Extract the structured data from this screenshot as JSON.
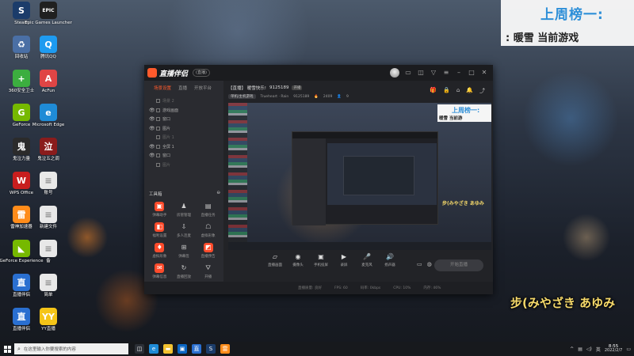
{
  "desktop": {
    "icons": [
      {
        "label": "Steam",
        "glyph": "S",
        "color": "#1b3c6a"
      },
      {
        "label": "Epic Games Launcher",
        "glyph": "EPIC",
        "color": "#202020"
      },
      {
        "label": "回收站",
        "glyph": "♻",
        "color": "#4a6fa5"
      },
      {
        "label": "腾讯QQ",
        "glyph": "Q",
        "color": "#1e9bf0"
      },
      {
        "label": "360安全卫士",
        "glyph": "+",
        "color": "#3cae3f"
      },
      {
        "label": "AcFun",
        "glyph": "A",
        "color": "#e04545"
      },
      {
        "label": "GeForce",
        "glyph": "G",
        "color": "#76b900"
      },
      {
        "label": "Microsoft Edge",
        "glyph": "e",
        "color": "#1f8bd6"
      },
      {
        "label": "鬼泣力量",
        "glyph": "鬼",
        "color": "#2b2b2b"
      },
      {
        "label": "鬼泣五之调",
        "glyph": "泣",
        "color": "#8a1c1c"
      },
      {
        "label": "WPS Office",
        "glyph": "W",
        "color": "#c81e1e"
      },
      {
        "label": "账号",
        "glyph": "≡",
        "color": "#e8e8e8"
      },
      {
        "label": "雷神加速器",
        "glyph": "雷",
        "color": "#ff8c1a"
      },
      {
        "label": "新建文件",
        "glyph": "≡",
        "color": "#e8e8e8"
      },
      {
        "label": "GeForce Experience",
        "glyph": "◣",
        "color": "#76b900"
      },
      {
        "label": "备",
        "glyph": "≡",
        "color": "#e8e8e8"
      },
      {
        "label": "直播伴侣",
        "glyph": "直",
        "color": "#2a6fd0"
      },
      {
        "label": "简单",
        "glyph": "≡",
        "color": "#e8e8e8"
      },
      {
        "label": "直播伴侣",
        "glyph": "直",
        "color": "#2a6fd0"
      },
      {
        "label": "YY直播",
        "glyph": "YY",
        "color": "#f5c518"
      }
    ]
  },
  "overlay": {
    "banner_title": "上周榜一:",
    "banner_sub": ": 暖雪   当前游戏",
    "lyric": "步(みやざき あゆみ"
  },
  "app": {
    "logo_text": "直播伴侣",
    "version": "(直播)",
    "side_tabs": [
      "场景设置",
      "直播",
      "开放平台"
    ],
    "scenes": [
      {
        "label": "场景 2",
        "eye": false
      },
      {
        "label": "游戏画面",
        "eye": true
      },
      {
        "label": "窗口",
        "eye": true
      },
      {
        "label": "图片",
        "eye": true
      },
      {
        "label": "图片 1",
        "eye": false
      },
      {
        "label": "全屏 1",
        "eye": true
      },
      {
        "label": "窗口",
        "eye": true
      },
      {
        "label": "图片",
        "eye": false
      }
    ],
    "toolbox_label": "工具箱",
    "tools": [
      {
        "label": "弹幕助手",
        "icon": "▣",
        "hot": true
      },
      {
        "label": "房管管理",
        "icon": "♟",
        "hot": false
      },
      {
        "label": "直播任务",
        "icon": "▤",
        "hot": false
      },
      {
        "label": "福利设置",
        "icon": "◧",
        "hot": true
      },
      {
        "label": "多人连麦",
        "icon": "⇩",
        "hot": false
      },
      {
        "label": "虚拟形象",
        "icon": "☖",
        "hot": false
      },
      {
        "label": "虚拟形象",
        "icon": "♦",
        "hot": true
      },
      {
        "label": "弹幕签",
        "icon": "⊞",
        "hot": false
      },
      {
        "label": "直播预告",
        "icon": "◩",
        "hot": true
      },
      {
        "label": "弹幕信息",
        "icon": "✉",
        "hot": true
      },
      {
        "label": "直播回放",
        "icon": "↻",
        "hot": false
      },
      {
        "label": "开播",
        "icon": "⛛",
        "hot": false
      }
    ],
    "side_footer": "您的直播间未开启更多功能请前往设置",
    "room_title": "【直播】 暖雪快乐!",
    "room_id": "9125189",
    "room_chip": "开播",
    "room_category": "单机/主机游戏",
    "room_user": "Trueheart · Rain",
    "room_uid": "9125189",
    "room_views": "2409",
    "room_count": "9",
    "preview_banner_title": "上周榜一:",
    "preview_banner_sub": "暖雪   当前游",
    "preview_lyric": "步(みやざき あゆみ",
    "controls": [
      {
        "label": "直播画面",
        "icon": "▱"
      },
      {
        "label": "摄像头",
        "icon": "◉"
      },
      {
        "label": "手机投屏",
        "icon": "▣"
      },
      {
        "label": "录屏",
        "icon": "▶"
      },
      {
        "label": "麦克风",
        "icon": "🎤"
      },
      {
        "label": "扬声器",
        "icon": "🔊"
      }
    ],
    "go_live": "开始直播",
    "status": [
      "直播质量: 良好",
      "FPS: 60",
      "码率: 0kbps",
      "CPU: 10%",
      "内存: 46%"
    ]
  },
  "taskbar": {
    "search_placeholder": "在这里输入你要搜索的内容",
    "time": "8:55",
    "date": "2022/2/7"
  }
}
